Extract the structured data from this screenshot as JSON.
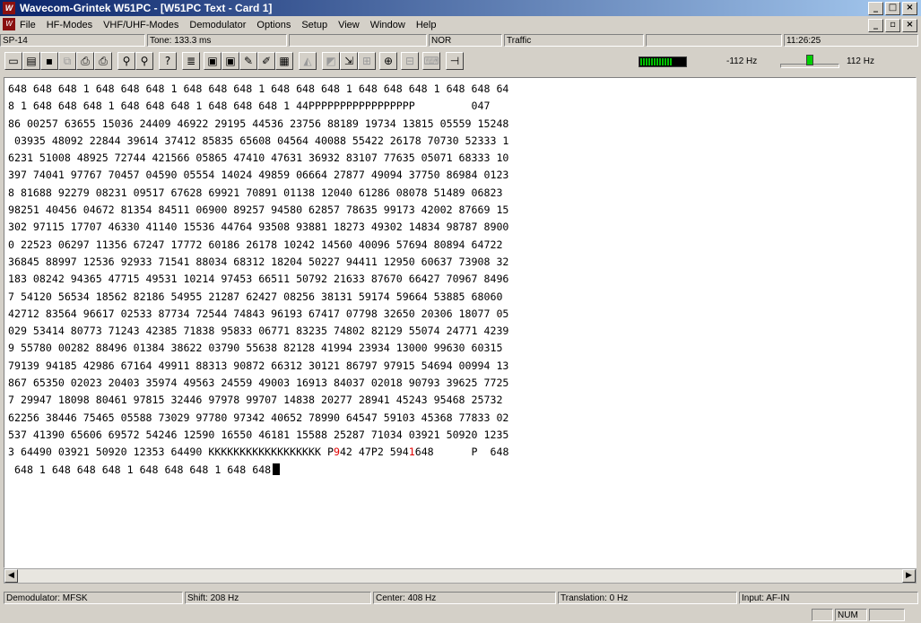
{
  "window": {
    "title": "Wavecom-Grintek W51PC - [W51PC Text  - Card 1]",
    "minimize": "_",
    "maximize": "□",
    "close": "×",
    "restore": "▫"
  },
  "menu": {
    "items": [
      "File",
      "HF-Modes",
      "VHF/UHF-Modes",
      "Demodulator",
      "Options",
      "Setup",
      "View",
      "Window",
      "Help"
    ]
  },
  "top_status": {
    "mode": "SP-14",
    "tone": "Tone: 133.3 ms",
    "polarity": "NOR",
    "state": "Traffic",
    "time": "11:26:25"
  },
  "toolbar": {
    "tuning_min": "-112 Hz",
    "tuning_max": "112 Hz",
    "level_fraction": 0.72,
    "tuning_fraction": 0.5
  },
  "text_lines": [
    "648 648 648 1 648 648 648 1 648 648 648 1 648 648 648 1 648 648 648 1 648 648 64",
    "8 1 648 648 648 1 648 648 648 1 648 648 648 1 44PPPPPPPPPPPPPPPPP         047",
    "86 00257 63655 15036 24409 46922 29195 44536 23756 88189 19734 13815 05559 15248",
    " 03935 48092 22844 39614 37412 85835 65608 04564 40088 55422 26178 70730 52333 1",
    "6231 51008 48925 72744 421566 05865 47410 47631 36932 83107 77635 05071 68333 10",
    "397 74041 97767 70457 04590 05554 14024 49859 06664 27877 49094 37750 86984 0123",
    "8 81688 92279 08231 09517 67628 69921 70891 01138 12040 61286 08078 51489 06823",
    "98251 40456 04672 81354 84511 06900 89257 94580 62857 78635 99173 42002 87669 15",
    "302 97115 17707 46330 41140 15536 44764 93508 93881 18273 49302 14834 98787 8900",
    "0 22523 06297 11356 67247 17772 60186 26178 10242 14560 40096 57694 80894 64722",
    "36845 88997 12536 92933 71541 88034 68312 18204 50227 94411 12950 60637 73908 32",
    "183 08242 94365 47715 49531 10214 97453 66511 50792 21633 87670 66427 70967 8496",
    "7 54120 56534 18562 82186 54955 21287 62427 08256 38131 59174 59664 53885 68060",
    "42712 83564 96617 02533 87734 72544 74843 96193 67417 07798 32650 20306 18077 05",
    "029 53414 80773 71243 42385 71838 95833 06771 83235 74802 82129 55074 24771 4239",
    "9 55780 00282 88496 01384 38622 03790 55638 82128 41994 23934 13000 99630 60315",
    "79139 94185 42986 67164 49911 88313 90872 66312 30121 86797 97915 54694 00994 13",
    "867 65350 02023 20403 35974 49563 24559 49003 16913 84037 02018 90793 39625 7725",
    "7 29947 18098 80461 97815 32446 97978 99707 14838 20277 28941 45243 95468 25732",
    "62256 38446 75465 05588 73029 97780 97342 40652 78990 64547 59103 45368 77833 02",
    "537 41390 65606 69572 54246 12590 16550 46181 15588 25287 71034 03921 50920 1235"
  ],
  "line22": {
    "a": "3 64490 03921 50920 12353 64490 KKKKKKKKKKKKKKKKKK P",
    "r1": "9",
    "b": "42 47P2 594",
    "r2": "1",
    "c": "648      P  648"
  },
  "line23": " 648 1 648 648 648 1 648 648 648 1 648 648",
  "bottom_status": {
    "demodulator": "Demodulator: MFSK",
    "shift": "Shift: 208 Hz",
    "center": "Center: 408 Hz",
    "translation": "Translation: 0 Hz",
    "input": "Input: AF-IN",
    "num": "NUM"
  }
}
